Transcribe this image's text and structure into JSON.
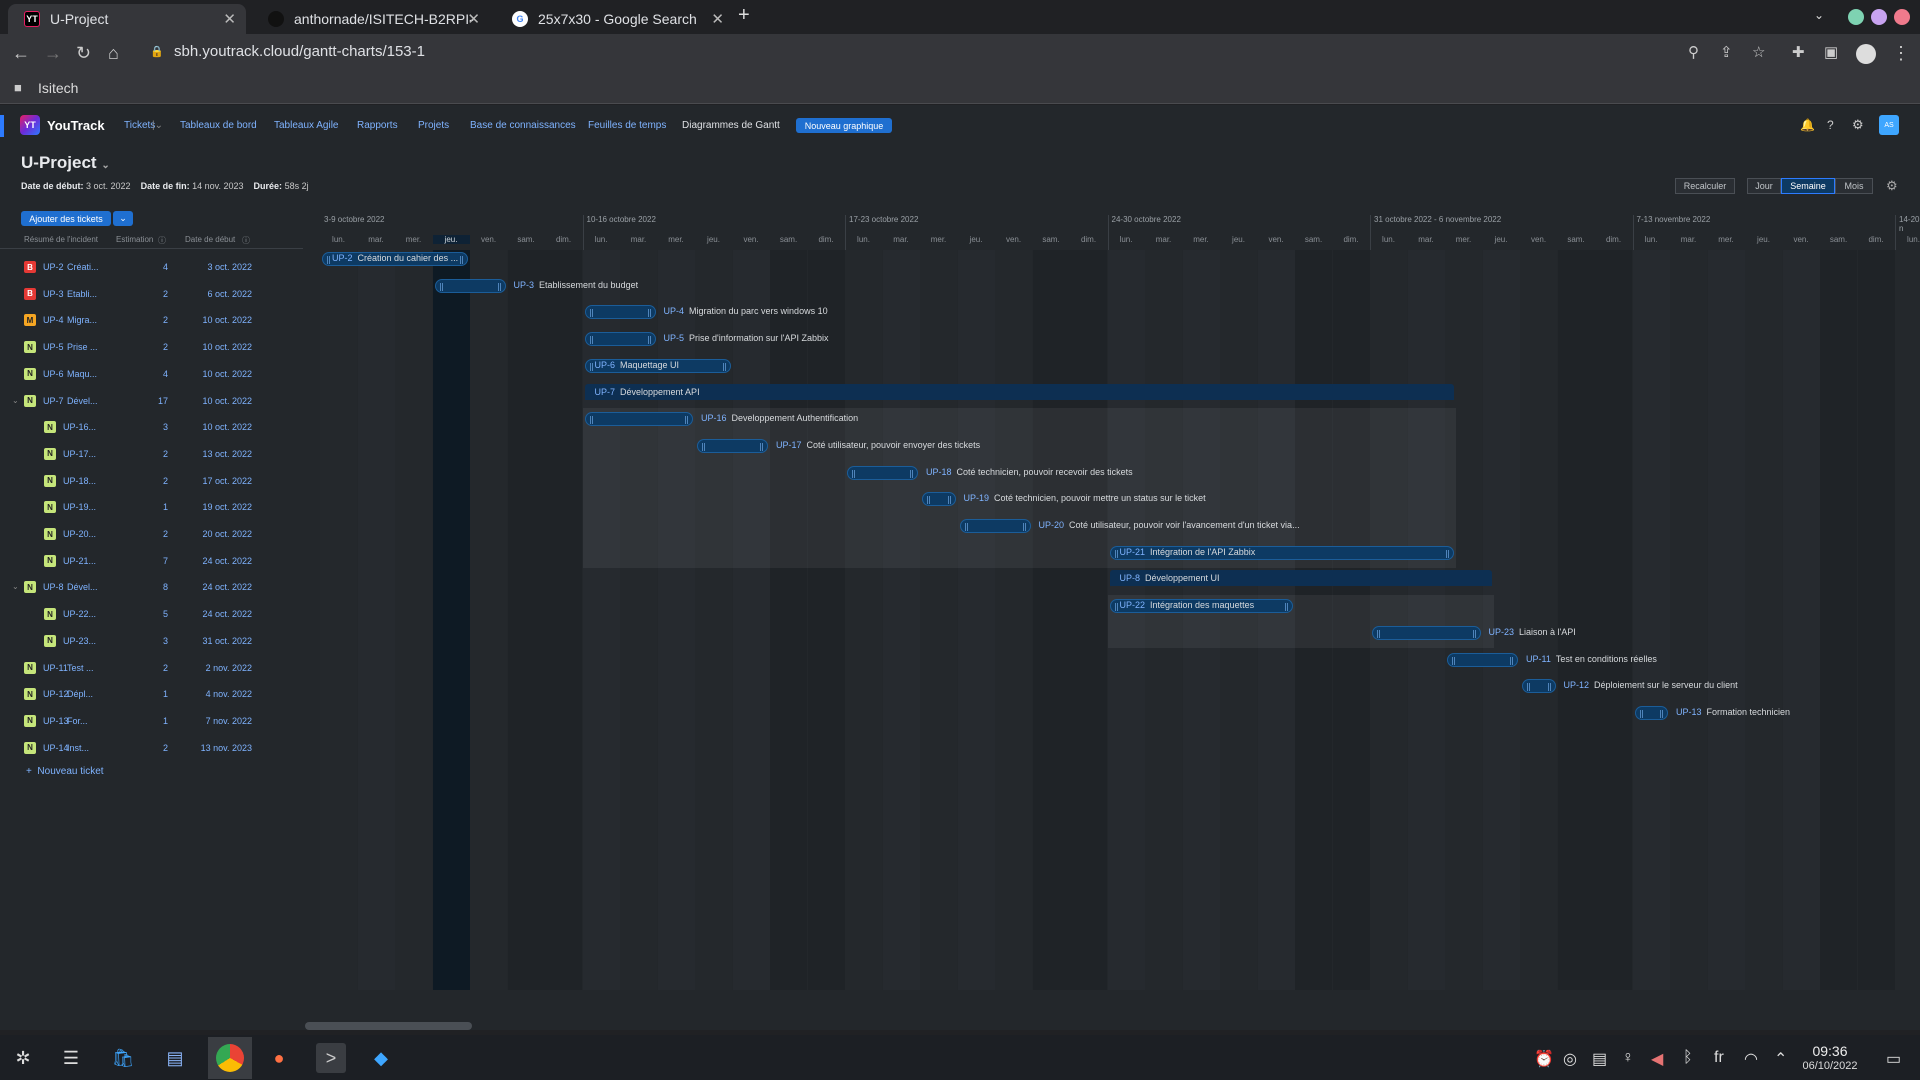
{
  "browser": {
    "tabs": [
      {
        "title": "U-Project",
        "icon": "youtrack-icon"
      },
      {
        "title": "anthornade/ISITECH-B2RPI-S",
        "icon": "github-icon"
      },
      {
        "title": "25x7x30 - Google Search",
        "icon": "google-icon"
      }
    ],
    "url": "sbh.youtrack.cloud/gantt-charts/153-1",
    "bookmark": "Isitech"
  },
  "header": {
    "logo": "YouTrack",
    "nav": [
      "Tickets",
      "Tableaux de bord",
      "Tableaux Agile",
      "Rapports",
      "Projets",
      "Base de connaissances",
      "Feuilles de temps",
      "Diagrammes de Gantt"
    ],
    "new_chart": "Nouveau graphique",
    "avatar": "AS"
  },
  "project": {
    "title": "U-Project",
    "start_label": "Date de début:",
    "start": "3 oct. 2022",
    "end_label": "Date de fin:",
    "end": "14 nov. 2023",
    "duration_label": "Durée:",
    "duration": "58s 2j"
  },
  "controls": {
    "add": "Ajouter des tickets",
    "recalc": "Recalculer",
    "scales": [
      "Jour",
      "Semaine",
      "Mois"
    ],
    "active_scale": "Semaine"
  },
  "list_headers": {
    "summary": "Résumé de l'incident",
    "estimation": "Estimation",
    "start": "Date de début"
  },
  "tickets": [
    {
      "type": "B",
      "id": "UP-2",
      "summary": "Créati...",
      "est": "4",
      "date": "3 oct. 2022"
    },
    {
      "type": "B",
      "id": "UP-3",
      "summary": "Etabli...",
      "est": "2",
      "date": "6 oct. 2022"
    },
    {
      "type": "M",
      "id": "UP-4",
      "summary": "Migra...",
      "est": "2",
      "date": "10 oct. 2022"
    },
    {
      "type": "N",
      "id": "UP-5",
      "summary": "Prise ...",
      "est": "2",
      "date": "10 oct. 2022"
    },
    {
      "type": "N",
      "id": "UP-6",
      "summary": "Maqu...",
      "est": "4",
      "date": "10 oct. 2022"
    },
    {
      "type": "N",
      "id": "UP-7",
      "summary": "Dével...",
      "est": "17",
      "date": "10 oct. 2022",
      "parent": true
    },
    {
      "type": "N",
      "id": "UP-16...",
      "summary": "",
      "est": "3",
      "date": "10 oct. 2022",
      "child": true
    },
    {
      "type": "N",
      "id": "UP-17...",
      "summary": "",
      "est": "2",
      "date": "13 oct. 2022",
      "child": true
    },
    {
      "type": "N",
      "id": "UP-18...",
      "summary": "",
      "est": "2",
      "date": "17 oct. 2022",
      "child": true
    },
    {
      "type": "N",
      "id": "UP-19...",
      "summary": "",
      "est": "1",
      "date": "19 oct. 2022",
      "child": true
    },
    {
      "type": "N",
      "id": "UP-20...",
      "summary": "",
      "est": "2",
      "date": "20 oct. 2022",
      "child": true
    },
    {
      "type": "N",
      "id": "UP-21...",
      "summary": "",
      "est": "7",
      "date": "24 oct. 2022",
      "child": true
    },
    {
      "type": "N",
      "id": "UP-8",
      "summary": "Dével...",
      "est": "8",
      "date": "24 oct. 2022",
      "parent": true
    },
    {
      "type": "N",
      "id": "UP-22...",
      "summary": "",
      "est": "5",
      "date": "24 oct. 2022",
      "child": true
    },
    {
      "type": "N",
      "id": "UP-23...",
      "summary": "",
      "est": "3",
      "date": "31 oct. 2022",
      "child": true
    },
    {
      "type": "N",
      "id": "UP-11",
      "summary": "Test ...",
      "est": "2",
      "date": "2 nov. 2022"
    },
    {
      "type": "N",
      "id": "UP-12",
      "summary": "Dépl...",
      "est": "1",
      "date": "4 nov. 2022"
    },
    {
      "type": "N",
      "id": "UP-13",
      "summary": "For...",
      "est": "1",
      "date": "7 nov. 2022"
    },
    {
      "type": "N",
      "id": "UP-14",
      "summary": "Inst...",
      "est": "2",
      "date": "13 nov. 2023"
    }
  ],
  "new_ticket": "Nouveau ticket",
  "weeks": [
    "3-9 octobre 2022",
    "10-16 octobre 2022",
    "17-23 octobre 2022",
    "24-30 octobre 2022",
    "31 octobre 2022 - 6 novembre 2022",
    "7-13 novembre 2022",
    "14-20 n"
  ],
  "days": [
    "lun.",
    "mar.",
    "mer.",
    "jeu.",
    "ven.",
    "sam.",
    "dim."
  ],
  "bars": [
    {
      "row": 0,
      "id": "UP-2",
      "name": "Création du cahier des ...",
      "inside": true
    },
    {
      "row": 1,
      "id": "UP-3",
      "name": "Etablissement du budget"
    },
    {
      "row": 2,
      "id": "UP-4",
      "name": "Migration du parc vers windows 10"
    },
    {
      "row": 3,
      "id": "UP-5",
      "name": "Prise d'information sur l'API Zabbix"
    },
    {
      "row": 4,
      "id": "UP-6",
      "name": "Maquettage UI",
      "inside": true
    },
    {
      "row": 5,
      "id": "UP-7",
      "name": "Développement API",
      "parent": true
    },
    {
      "row": 6,
      "id": "UP-16",
      "name": "Developpement Authentification"
    },
    {
      "row": 7,
      "id": "UP-17",
      "name": "Coté utilisateur, pouvoir envoyer des tickets"
    },
    {
      "row": 8,
      "id": "UP-18",
      "name": "Coté technicien, pouvoir recevoir des tickets"
    },
    {
      "row": 9,
      "id": "UP-19",
      "name": "Coté technicien, pouvoir mettre un status sur le ticket"
    },
    {
      "row": 10,
      "id": "UP-20",
      "name": "Coté utilisateur, pouvoir voir l'avancement d'un ticket via..."
    },
    {
      "row": 11,
      "id": "UP-21",
      "name": "Intégration de l'API Zabbix",
      "inside": true
    },
    {
      "row": 12,
      "id": "UP-8",
      "name": "Développement UI",
      "parent": true
    },
    {
      "row": 13,
      "id": "UP-22",
      "name": "Intégration des maquettes",
      "inside": true
    },
    {
      "row": 14,
      "id": "UP-23",
      "name": "Liaison à l'API"
    },
    {
      "row": 15,
      "id": "UP-11",
      "name": "Test en conditions réelles"
    },
    {
      "row": 16,
      "id": "UP-12",
      "name": "Déploiement sur le serveur du client"
    },
    {
      "row": 17,
      "id": "UP-13",
      "name": "Formation technicien"
    }
  ],
  "taskbar": {
    "lang": "fr",
    "time": "09:36",
    "date": "06/10/2022"
  },
  "colors": {
    "accent": "#1f6fd0",
    "bar": "#0d3a63",
    "link": "#7fb3ff",
    "bug": "#e53935",
    "feature": "#c5e57a",
    "task": "#f5a623"
  }
}
